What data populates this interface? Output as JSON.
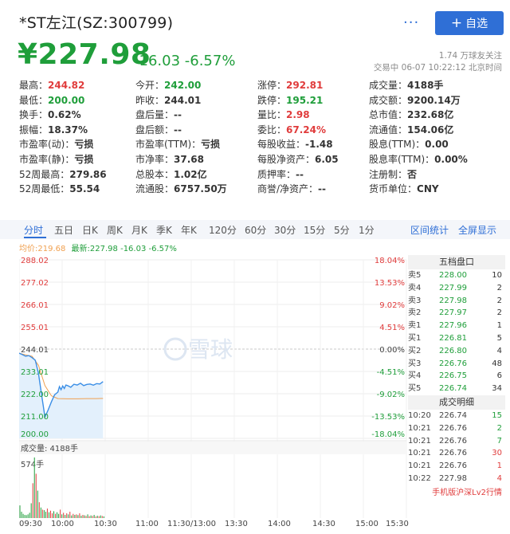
{
  "header": {
    "title": "*ST左江(SZ:300799)",
    "more_label": "···",
    "add_label": "自选",
    "price": "¥227.98",
    "change": "-16.03",
    "change_pct": "-6.57%",
    "follow": "1.74 万球友关注",
    "trade_time": "交易中 06-07 10:22:12 北京时间"
  },
  "quotes": [
    [
      {
        "k": "最高：",
        "v": "244.82",
        "c": "red"
      },
      {
        "k": "今开：",
        "v": "242.00",
        "c": "green"
      },
      {
        "k": "涨停：",
        "v": "292.81",
        "c": "red"
      },
      {
        "k": "成交量：",
        "v": "4188手",
        "c": "n"
      }
    ],
    [
      {
        "k": "最低：",
        "v": "200.00",
        "c": "green"
      },
      {
        "k": "昨收：",
        "v": "244.01",
        "c": "n"
      },
      {
        "k": "跌停：",
        "v": "195.21",
        "c": "green"
      },
      {
        "k": "成交额：",
        "v": "9200.14万",
        "c": "n"
      }
    ],
    [
      {
        "k": "换手：",
        "v": "0.62%",
        "c": "n"
      },
      {
        "k": "盘后量：",
        "v": "--",
        "c": "n"
      },
      {
        "k": "量比：",
        "v": "2.98",
        "c": "red"
      },
      {
        "k": "总市值：",
        "v": "232.68亿",
        "c": "n"
      }
    ],
    [
      {
        "k": "振幅：",
        "v": "18.37%",
        "c": "n"
      },
      {
        "k": "盘后额：",
        "v": "--",
        "c": "n"
      },
      {
        "k": "委比：",
        "v": "67.24%",
        "c": "red"
      },
      {
        "k": "流通值：",
        "v": "154.06亿",
        "c": "n"
      }
    ],
    [
      {
        "k": "市盈率(动)：",
        "v": "亏损",
        "c": "n"
      },
      {
        "k": "市盈率(TTM)：",
        "v": "亏损",
        "c": "n"
      },
      {
        "k": "每股收益：",
        "v": "-1.48",
        "c": "n"
      },
      {
        "k": "股息(TTM)：",
        "v": "0.00",
        "c": "n"
      }
    ],
    [
      {
        "k": "市盈率(静)：",
        "v": "亏损",
        "c": "n"
      },
      {
        "k": "市净率：",
        "v": "37.68",
        "c": "n"
      },
      {
        "k": "每股净资产：",
        "v": "6.05",
        "c": "n"
      },
      {
        "k": "股息率(TTM)：",
        "v": "0.00%",
        "c": "n"
      }
    ],
    [
      {
        "k": "52周最高：",
        "v": "279.86",
        "c": "n"
      },
      {
        "k": "总股本：",
        "v": "1.02亿",
        "c": "n"
      },
      {
        "k": "质押率：",
        "v": "--",
        "c": "n"
      },
      {
        "k": "注册制：",
        "v": "否",
        "c": "n"
      }
    ],
    [
      {
        "k": "52周最低：",
        "v": "55.54",
        "c": "n"
      },
      {
        "k": "流通股：",
        "v": "6757.50万",
        "c": "n"
      },
      {
        "k": "商誉/净资产：",
        "v": "--",
        "c": "n"
      },
      {
        "k": "货币单位：",
        "v": "CNY",
        "c": "n"
      }
    ]
  ],
  "tabs": [
    "分时",
    "五日",
    "日K",
    "周K",
    "月K",
    "季K",
    "年K",
    "120分",
    "60分",
    "30分",
    "15分",
    "5分",
    "1分"
  ],
  "tab_links": [
    "区间统计",
    "全屏显示"
  ],
  "avg_line": {
    "label": "均价:219.68",
    "latest": "最新:227.98 -16.03 -6.57%"
  },
  "watermark": "雪球",
  "volume_label": "成交量: 4188手",
  "volume_max_label": "574手",
  "order_book": {
    "title": "五档盘口",
    "asks": [
      {
        "label": "卖5",
        "price": "228.00",
        "vol": "10"
      },
      {
        "label": "卖4",
        "price": "227.99",
        "vol": "2"
      },
      {
        "label": "卖3",
        "price": "227.98",
        "vol": "2"
      },
      {
        "label": "卖2",
        "price": "227.97",
        "vol": "2"
      },
      {
        "label": "卖1",
        "price": "227.96",
        "vol": "1"
      }
    ],
    "bids": [
      {
        "label": "买1",
        "price": "226.81",
        "vol": "5"
      },
      {
        "label": "买2",
        "price": "226.80",
        "vol": "4"
      },
      {
        "label": "买3",
        "price": "226.76",
        "vol": "48"
      },
      {
        "label": "买4",
        "price": "226.75",
        "vol": "6"
      },
      {
        "label": "买5",
        "price": "226.74",
        "vol": "34"
      }
    ],
    "trades_title": "成交明细",
    "trades": [
      {
        "time": "10:20",
        "price": "226.74",
        "vol": "15",
        "c": "green"
      },
      {
        "time": "10:21",
        "price": "226.76",
        "vol": "2",
        "c": "green"
      },
      {
        "time": "10:21",
        "price": "226.76",
        "vol": "7",
        "c": "green"
      },
      {
        "time": "10:21",
        "price": "226.76",
        "vol": "30",
        "c": "red"
      },
      {
        "time": "10:21",
        "price": "226.76",
        "vol": "1",
        "c": "red"
      },
      {
        "time": "10:22",
        "price": "227.98",
        "vol": "4",
        "c": "red"
      }
    ],
    "lv2": "手机版沪深Lv2行情"
  },
  "colors": {
    "up": "#e03c3c",
    "down": "#1f9e3a",
    "accent": "#2f6fd6",
    "avg": "#f0a050",
    "price_line": "#3a8ee6"
  },
  "chart_data": {
    "type": "line",
    "x_ticks": [
      "09:30",
      "10:00",
      "10:30",
      "11:00",
      "11:30/13:00",
      "13:30",
      "14:00",
      "14:30",
      "15:00",
      "15:30"
    ],
    "y_ticks": [
      "288.02",
      "277.02",
      "266.01",
      "255.01",
      "244.01",
      "233.01",
      "222.00",
      "211.00",
      "200.00"
    ],
    "pct_ticks": [
      "18.04%",
      "13.53%",
      "9.02%",
      "4.51%",
      "0.00%",
      "-4.51%",
      "-9.02%",
      "-13.53%",
      "-18.04%"
    ],
    "ylim": [
      200.0,
      288.02
    ],
    "prev_close": 244.01,
    "series": [
      {
        "x": [
          0,
          2,
          4,
          6,
          8,
          10,
          12,
          14,
          16,
          18,
          20,
          22,
          24,
          25,
          26,
          27,
          28,
          29,
          30,
          32,
          34,
          36,
          38,
          40,
          42,
          44,
          46,
          48,
          50,
          52
        ],
        "values": [
          242.0,
          241.3,
          240.5,
          240.8,
          239.8,
          238.5,
          232.0,
          221.0,
          210.5,
          214.0,
          218.0,
          221.5,
          222.8,
          225.5,
          224.0,
          225.8,
          224.6,
          226.3,
          226.0,
          225.2,
          226.7,
          226.3,
          227.2,
          226.0,
          226.6,
          226.8,
          226.2,
          227.0,
          226.8,
          227.98
        ]
      },
      {
        "x": [
          0,
          4,
          8,
          12,
          16,
          20,
          24,
          30,
          36,
          42,
          48,
          52
        ],
        "values": [
          242.0,
          241.2,
          240.5,
          236.0,
          226.0,
          221.0,
          219.6,
          219.5,
          219.5,
          219.6,
          219.6,
          219.68
        ]
      }
    ],
    "volumes": [
      120,
      60,
      40,
      30,
      28,
      35,
      50,
      140,
      330,
      574,
      420,
      260,
      150,
      100,
      80,
      75,
      60,
      90,
      55,
      70,
      45,
      65,
      40,
      55,
      40,
      80,
      35,
      50,
      30,
      45,
      35,
      60,
      25,
      40,
      30,
      35,
      28,
      45,
      22,
      30,
      26,
      20,
      35,
      18,
      25,
      20,
      30,
      15,
      22,
      18,
      25,
      20,
      16
    ],
    "volume_colors": [
      "g",
      "g",
      "g",
      "g",
      "g",
      "g",
      "g",
      "g",
      "r",
      "g",
      "r",
      "g",
      "r",
      "g",
      "r",
      "g",
      "g",
      "r",
      "g",
      "r",
      "r",
      "g",
      "r",
      "g",
      "g",
      "r",
      "g",
      "r",
      "g",
      "r",
      "g",
      "r",
      "g",
      "r",
      "g",
      "r",
      "g",
      "r",
      "g",
      "r",
      "g",
      "r",
      "g",
      "r",
      "g",
      "r",
      "g",
      "r",
      "g",
      "r",
      "g",
      "r",
      "g"
    ]
  }
}
